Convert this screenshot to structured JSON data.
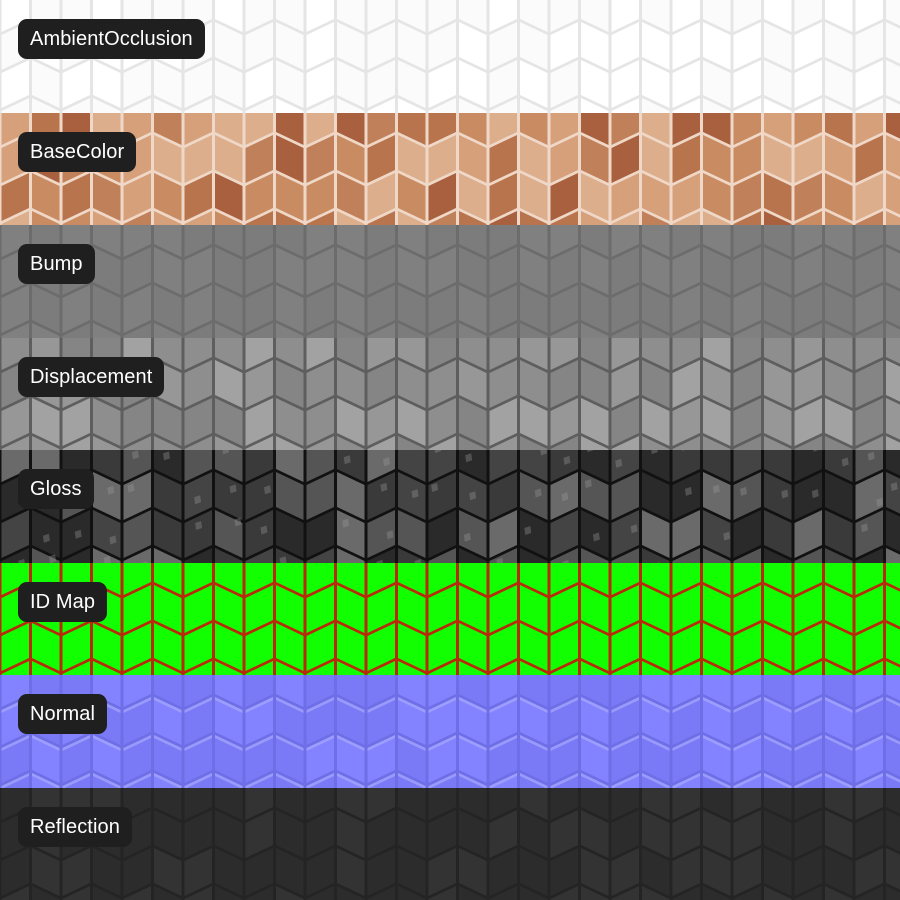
{
  "maps": [
    {
      "label": "AmbientOcclusion",
      "style": "ao",
      "base": "#f4f4f4",
      "tile": "#ffffff",
      "tile2": "#fafafa",
      "grout": "#dcdcdc"
    },
    {
      "label": "BaseColor",
      "style": "basecolor",
      "base": "#c98a62",
      "tile": "#c58558",
      "tile2": "#a86440",
      "grout": "#f0d8c8"
    },
    {
      "label": "Bump",
      "style": "bump",
      "base": "#808080",
      "tile": "#808080",
      "tile2": "#7c7c7c",
      "grout": "#6c6c6c"
    },
    {
      "label": "Displacement",
      "style": "displacement",
      "base": "#8e8e8e",
      "tile": "#9a9a9a",
      "tile2": "#8a8a8a",
      "grout": "#5e5e5e"
    },
    {
      "label": "Gloss",
      "style": "gloss",
      "base": "#262626",
      "tile": "#5a5a5a",
      "tile2": "#333333",
      "grout": "#111111"
    },
    {
      "label": "ID Map",
      "style": "idmap",
      "base": "#c83010",
      "tile": "#11ff00",
      "tile2": "#11ff00",
      "grout": "#b82a0a"
    },
    {
      "label": "Normal",
      "style": "normal",
      "base": "#7f7fff",
      "tile": "#8383ff",
      "tile2": "#7a7af6",
      "grout": "#6e6ee6"
    },
    {
      "label": "Reflection",
      "style": "reflection",
      "base": "#2e2e2e",
      "tile": "#333333",
      "tile2": "#2c2c2c",
      "grout": "#242424"
    }
  ]
}
